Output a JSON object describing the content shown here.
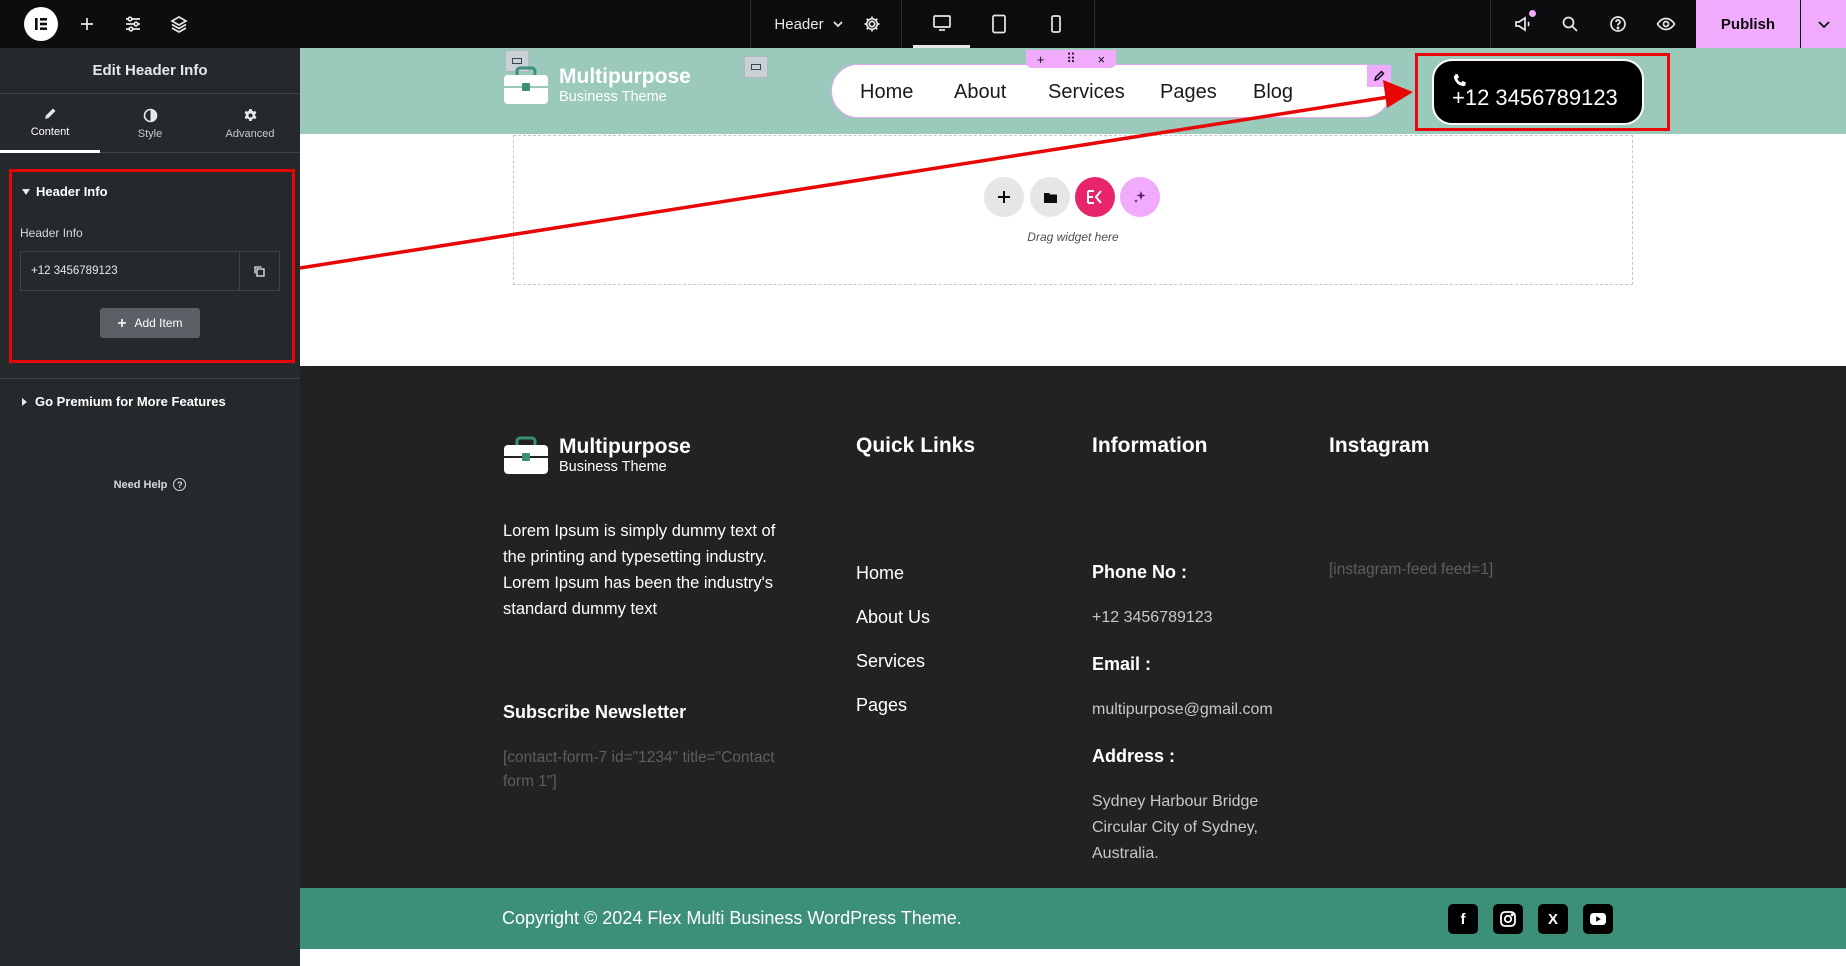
{
  "topbar": {
    "document_title": "Header",
    "publish_label": "Publish",
    "icons": [
      "elementor-logo-icon",
      "plus-icon",
      "sliders-icon",
      "layers-icon",
      "chevron-down-icon",
      "gear-icon",
      "desktop-icon",
      "tablet-icon",
      "mobile-icon",
      "megaphone-icon",
      "search-icon",
      "help-icon",
      "eye-icon"
    ]
  },
  "panel": {
    "title": "Edit Header Info",
    "tabs": [
      {
        "label": "Content",
        "icon": "pencil-icon",
        "active": true
      },
      {
        "label": "Style",
        "icon": "contrast-icon",
        "active": false
      },
      {
        "label": "Advanced",
        "icon": "gear-icon",
        "active": false
      }
    ],
    "section_title": "Header Info",
    "field_label": "Header Info",
    "repeater_item": "+12 3456789123",
    "add_item_label": "Add Item",
    "premium_section": "Go Premium for More Features",
    "need_help": "Need Help",
    "help_symbol": "?"
  },
  "header": {
    "brand_name": "Multipurpose",
    "brand_sub": "Business Theme",
    "nav": [
      "Home",
      "About",
      "Services",
      "Pages",
      "Blog"
    ],
    "handle_icons": [
      "+",
      "⠿",
      "×"
    ],
    "phone": "+12 3456789123"
  },
  "dropzone": {
    "text": "Drag widget here"
  },
  "footer": {
    "brand_name": "Multipurpose",
    "brand_sub": "Business Theme",
    "about": "Lorem Ipsum is simply dummy text of the printing and typesetting industry. Lorem Ipsum has been the industry's standard dummy text",
    "newsletter_title": "Subscribe Newsletter",
    "newsletter_shortcode": "[contact-form-7 id=\"1234\" title=\"Contact form 1\"]",
    "quick_links_title": "Quick Links",
    "quick_links": [
      "Home",
      "About Us",
      "Services",
      "Pages"
    ],
    "info_title": "Information",
    "phone_label": "Phone No :",
    "phone_value": "+12 3456789123",
    "email_label": "Email :",
    "email_value": "multipurpose@gmail.com",
    "address_label": "Address :",
    "address_value": "Sydney Harbour Bridge Circular City of Sydney, Australia.",
    "instagram_title": "Instagram",
    "instagram_shortcode": "[instagram-feed feed=1]",
    "copyright": "Copyright © 2024 Flex Multi Business WordPress Theme.",
    "social": [
      {
        "name": "facebook-icon",
        "glyph": "f"
      },
      {
        "name": "instagram-icon",
        "glyph": ""
      },
      {
        "name": "x-icon",
        "glyph": "X"
      },
      {
        "name": "youtube-icon",
        "glyph": ""
      }
    ]
  },
  "colors": {
    "accent": "#f0abfc",
    "header_bg": "#9bcabd",
    "footer_bg": "#222222",
    "copyright_bg": "#3c8f78",
    "highlight": "#e80606",
    "pink_button": "#e8246a"
  }
}
